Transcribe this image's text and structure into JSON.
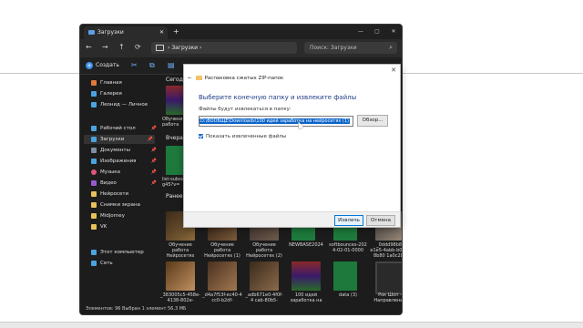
{
  "explorer": {
    "tab_title": "Загрузки",
    "tab_close": "✕",
    "new_tab": "+",
    "window_controls": [
      "—",
      "▢",
      "✕"
    ],
    "address": {
      "path_segment": "Загрузки",
      "separator": "›"
    },
    "search_placeholder": "Поиск: Загрузки",
    "create_label": "Создать",
    "sidebar": {
      "items": [
        {
          "label": "Главная",
          "icon": "home-icon",
          "color": "#e07a3a"
        },
        {
          "label": "Галерея",
          "icon": "gallery-icon",
          "color": "#4aa3df"
        },
        {
          "label": "Леонид — Личное",
          "icon": "cloud-icon",
          "color": "#4aa3df"
        },
        {
          "label": "Рабочий стол",
          "icon": "desktop-icon",
          "color": "#4aa3df",
          "pinned": true
        },
        {
          "label": "Загрузки",
          "icon": "download-icon",
          "color": "#4aa3df",
          "pinned": true,
          "selected": true
        },
        {
          "label": "Документы",
          "icon": "documents-icon",
          "color": "#7d8fa3",
          "pinned": true
        },
        {
          "label": "Изображения",
          "icon": "pictures-icon",
          "color": "#4aa3df",
          "pinned": true
        },
        {
          "label": "Музыка",
          "icon": "music-icon",
          "color": "#e0557a",
          "pinned": true
        },
        {
          "label": "Видео",
          "icon": "video-icon",
          "color": "#9b59d0",
          "pinned": true
        },
        {
          "label": "Нейросети",
          "icon": "folder-icon",
          "color": "#e8c15a"
        },
        {
          "label": "Снимки экрана",
          "icon": "folder-icon",
          "color": "#e8c15a"
        },
        {
          "label": "Midjorney",
          "icon": "folder-icon",
          "color": "#e8c15a"
        },
        {
          "label": "VK",
          "icon": "folder-icon",
          "color": "#e8c15a"
        },
        {
          "label": "Этот компьютер",
          "icon": "computer-icon",
          "color": "#4aa3df"
        },
        {
          "label": "Сеть",
          "icon": "network-icon",
          "color": "#4aa3df"
        }
      ]
    },
    "groups": [
      "Сегодн",
      "Вчера",
      "Ранее"
    ],
    "files_partial": [
      {
        "name": "Обучени работа"
      },
      {
        "name": "list-subsc g45?v="
      }
    ],
    "files_row1": [
      {
        "name": "Обучение работа Нейросетях"
      },
      {
        "name": "Обучение работа Нейросетях (1)"
      },
      {
        "name": "Обучение работа Нейросетях (2)"
      },
      {
        "name": "NEWBASE2024"
      },
      {
        "name": "softbounces-202 4-02-01-0000"
      },
      {
        "name": "_0ddd98b8-e1e5-4abb-b050-8b80 1a0c287"
      }
    ],
    "files_row2": [
      {
        "name": "_383005c5-458e-4138-802e-a28fc1"
      },
      {
        "name": "_d4a7f53f-ec40-4 cc0-b2df-ee80856"
      },
      {
        "name": "_adb671e0-4f0f-4 cab-80b5-d1e44f"
      },
      {
        "name": "100 идей заработка на"
      },
      {
        "name": "data (3)"
      },
      {
        "name": "Рок Шоп - Направление"
      }
    ],
    "status": "Элементов: 96   Выбран 1 элемент 56,3 МБ"
  },
  "dialog": {
    "title": "Распаковка сжатых ZIP-папок",
    "heading": "Выберите конечную папку и извлеките файлы",
    "path_label": "Файлы будут извлекаться в папку:",
    "path_value": "D:\\ВООБЩЕ\\Downloads\\100 идей заработка на нейросетях (1)",
    "browse_label": "Обзор...",
    "checkbox_label": "Показать извлеченные файлы",
    "checkbox_checked": true,
    "extract_label": "Извлечь",
    "cancel_label": "Отмена"
  }
}
